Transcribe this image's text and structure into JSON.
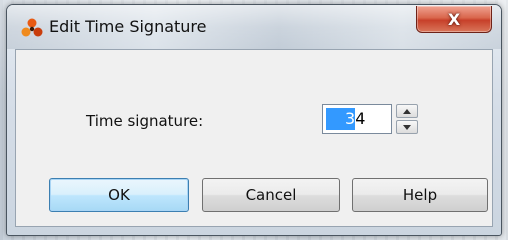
{
  "dialog": {
    "title": "Edit Time Signature",
    "close_label": "X"
  },
  "form": {
    "time_signature_label": "Time signature:",
    "time_signature_value": "3/4",
    "time_signature_selected": "3",
    "time_signature_rest": "4"
  },
  "buttons": {
    "ok": "OK",
    "cancel": "Cancel",
    "help": "Help"
  },
  "colors": {
    "selection": "#3399ff",
    "close_button": "#c7402a",
    "default_button_border": "#3c7fb1"
  },
  "icons": {
    "app": "reason-app-icon",
    "spin_up": "spin-up-arrow-icon",
    "spin_down": "spin-down-arrow-icon"
  }
}
